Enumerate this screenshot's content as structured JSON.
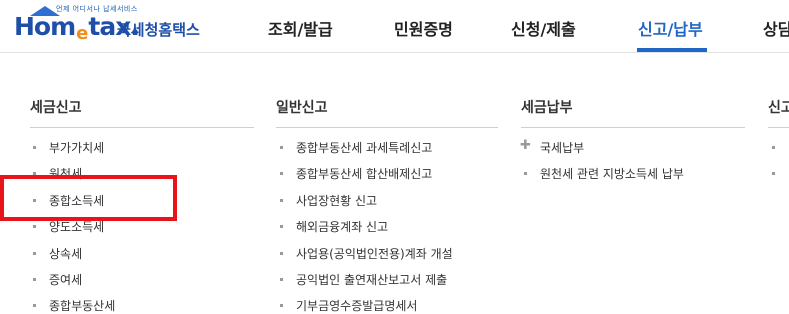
{
  "logo": {
    "tagline": "언제 어디서나 납세서비스",
    "brand_home": "Hom",
    "brand_e": "e",
    "brand_tax": "tax.",
    "brand_kr": "국세청홈택스"
  },
  "nav": [
    {
      "label": "조회/발급"
    },
    {
      "label": "민원증명"
    },
    {
      "label": "신청/제출"
    },
    {
      "label": "신고/납부",
      "active": true
    },
    {
      "label": "상담"
    }
  ],
  "columns": [
    {
      "title": "세금신고",
      "items": [
        "부가가치세",
        "원천세",
        "종합소득세",
        "양도소득세",
        "상속세",
        "증여세",
        "종합부동산세"
      ]
    },
    {
      "title": "일반신고",
      "items": [
        "종합부동산세 과세특례신고",
        "종합부동산세 합산배제신고",
        "사업장현황 신고",
        "해외금융계좌 신고",
        "사업용(공익법인전용)계좌 개설",
        "공익법인 출연재산보고서 제출",
        "기부금영수증발급명세서"
      ]
    },
    {
      "title": "세금납부",
      "items": [
        "국세납부",
        "원천세 관련 지방소득세 납부"
      ]
    },
    {
      "title": "신고"
    }
  ],
  "colors": {
    "accent": "#1f66c7",
    "highlight": "#e8141a"
  }
}
